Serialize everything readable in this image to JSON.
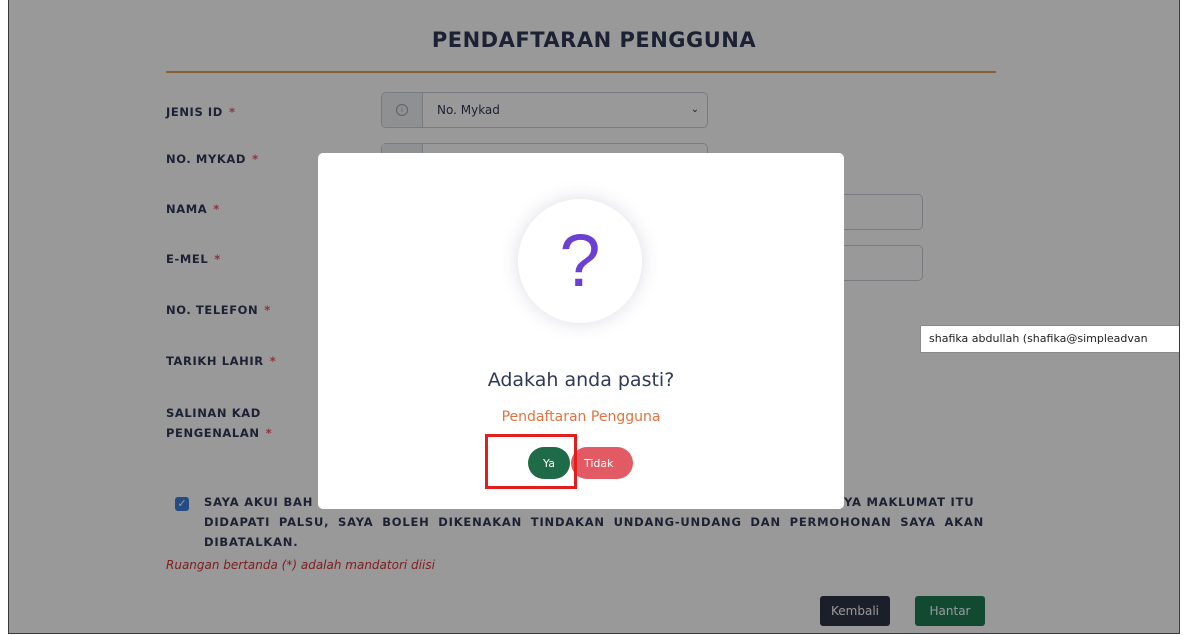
{
  "form": {
    "title": "PENDAFTARAN PENGGUNA",
    "fields": [
      {
        "label": "JENIS ID",
        "required": "*"
      },
      {
        "label": "NO. MYKAD",
        "required": "*"
      },
      {
        "label": "NAMA",
        "required": "*"
      },
      {
        "label": "E-MEL",
        "required": "*"
      },
      {
        "label": "NO. TELEFON",
        "required": "*"
      },
      {
        "label": "TARIKH LAHIR",
        "required": "*"
      },
      {
        "label": "SALINAN KAD",
        "label_line2": "PENGENALAN",
        "required": "*"
      }
    ],
    "id_type_value": "No. Mykad",
    "declaration_part1": "SAYA AKUI BAH",
    "declaration_part2": "YA MAKLUMAT ITU",
    "declaration_part3": "DIDAPATI PALSU, SAYA BOLEH DIKENAKAN TINDAKAN UNDANG-UNDANG DAN PERMOHONAN SAYA AKAN DIBATALKAN.",
    "checkbox_checked": true,
    "mandatory_note": "Ruangan bertanda (*) adalah mandatori diisi",
    "back_button": "Kembali",
    "submit_button": "Hantar"
  },
  "tooltip": {
    "text": "shafika abdullah (shafika@simpleadvan"
  },
  "modal": {
    "icon": "question-mark-icon",
    "icon_glyph": "?",
    "title": "Adakah anda pasti?",
    "subtitle": "Pendaftaran Pengguna",
    "confirm_button": "Ya",
    "cancel_button": "Tidak"
  },
  "colors": {
    "confirm": "#1f6b47",
    "cancel": "#e25a64",
    "icon": "#6b3fd1",
    "subtitle": "#e0733f",
    "highlight": "#e11d1d"
  }
}
